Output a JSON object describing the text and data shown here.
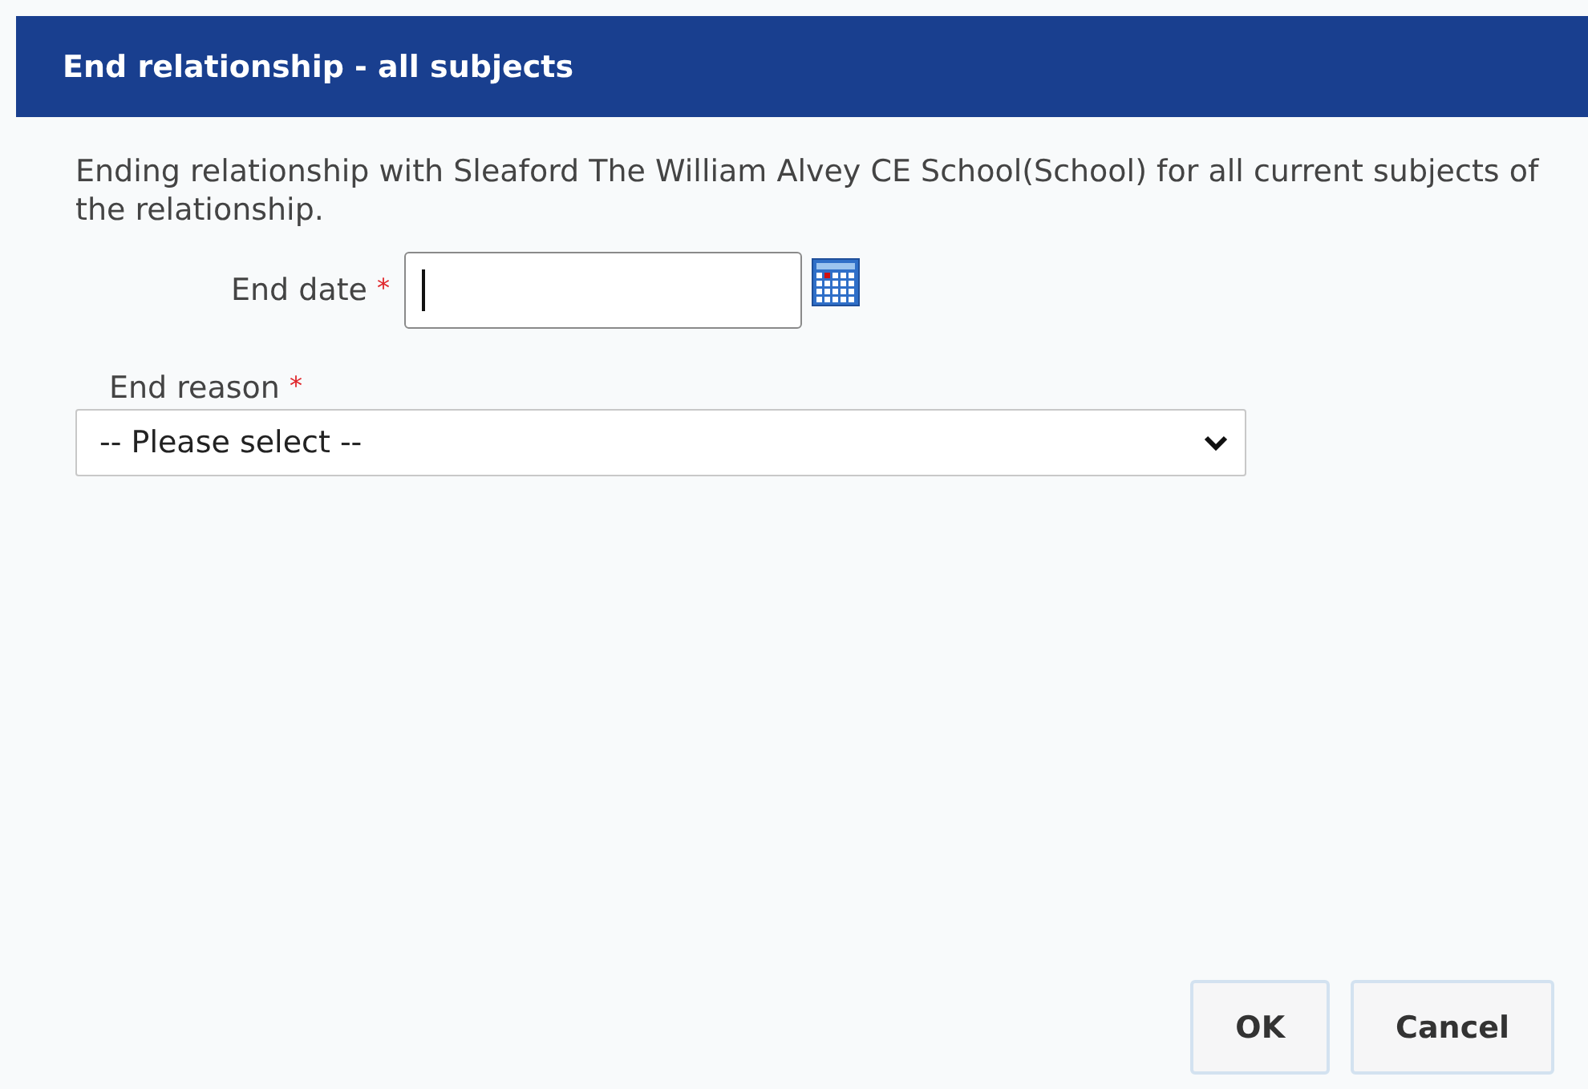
{
  "dialog": {
    "title": "End relationship - all subjects"
  },
  "message": "Ending relationship with Sleaford The William Alvey CE School(School) for all current subjects of the relationship.",
  "end_date": {
    "label": "End date",
    "required_mark": "*",
    "focused": true
  },
  "end_reason": {
    "label": "End reason",
    "required_mark": "*",
    "value": "-- Please select --"
  },
  "buttons": [
    "OK",
    "Cancel"
  ]
}
